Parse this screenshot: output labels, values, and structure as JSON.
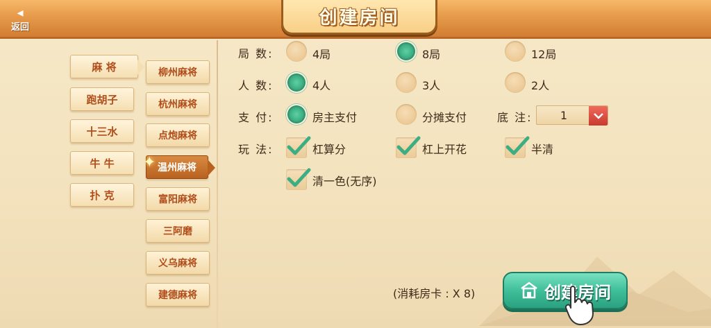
{
  "header": {
    "back_arrow": "◂",
    "back_label": "返回",
    "title": "创建房间"
  },
  "categories": [
    {
      "label": "麻 将",
      "active": true
    },
    {
      "label": "跑胡子",
      "active": false
    },
    {
      "label": "十三水",
      "active": false
    },
    {
      "label": "牛 牛",
      "active": false
    },
    {
      "label": "扑 克",
      "active": false
    }
  ],
  "games": [
    {
      "label": "柳州麻将",
      "active": false
    },
    {
      "label": "杭州麻将",
      "active": false
    },
    {
      "label": "点炮麻将",
      "active": false
    },
    {
      "label": "温州麻将",
      "active": true
    },
    {
      "label": "富阳麻将",
      "active": false
    },
    {
      "label": "三阿磨",
      "active": false
    },
    {
      "label": "义乌麻将",
      "active": false
    },
    {
      "label": "建德麻将",
      "active": false
    }
  ],
  "options": {
    "rounds": {
      "label": "局 数:",
      "choices": [
        "4局",
        "8局",
        "12局"
      ],
      "selected": "8局"
    },
    "players": {
      "label": "人 数:",
      "choices": [
        "4人",
        "3人",
        "2人"
      ],
      "selected": "4人"
    },
    "payment": {
      "label": "支 付:",
      "choices": [
        "房主支付",
        "分摊支付"
      ],
      "selected": "房主支付"
    },
    "base_bet": {
      "label": "底 注:",
      "value": "1"
    },
    "rules": {
      "label": "玩 法:",
      "choices": [
        "杠算分",
        "杠上开花",
        "半清",
        "清一色(无序)"
      ],
      "checked": [
        "杠算分",
        "杠上开花",
        "半清",
        "清一色(无序)"
      ]
    }
  },
  "footer": {
    "cost_text": "(消耗房卡 : X 8)",
    "create_label": "创建房间"
  },
  "colors": {
    "accent_orange": "#e69a4a",
    "radio_selected": "#3cae82",
    "create_button": "#3fbf9a",
    "text_brown": "#b04d1a",
    "dropdown_red": "#c83a2f"
  },
  "icons": {
    "back": "back-arrow-icon",
    "dropdown": "chevron-down-icon",
    "create": "house-icon",
    "hand": "pointing-hand-icon",
    "sparkle": "sparkle-icon",
    "check": "checkmark-icon"
  }
}
